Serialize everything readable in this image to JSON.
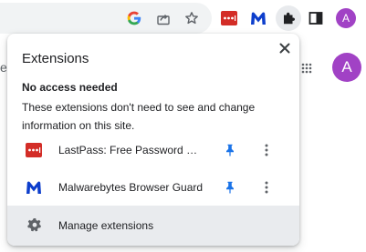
{
  "toolbar": {
    "google_icon": "google-g-icon",
    "share_icon": "share-icon",
    "bookmark_icon": "star-icon",
    "extensions": [
      {
        "name": "lastpass-extension-icon"
      },
      {
        "name": "malwarebytes-extension-icon"
      }
    ],
    "puzzle_icon": "puzzle-icon",
    "sidepanel_icon": "side-panel-icon",
    "avatar_letter": "A"
  },
  "page": {
    "edge_text": "e",
    "avatar_letter": "A"
  },
  "popup": {
    "title": "Extensions",
    "close_icon": "close-icon",
    "section_title": "No access needed",
    "section_desc": "These extensions don't need to see and change information on this site.",
    "items": [
      {
        "label": "LastPass: Free Password Manager",
        "icon": "lastpass-icon",
        "pinned": true
      },
      {
        "label": "Malwarebytes Browser Guard",
        "icon": "malwarebytes-icon",
        "pinned": true
      }
    ],
    "manage_label": "Manage extensions"
  },
  "colors": {
    "accent": "#1a73e8",
    "lastpass": "#d32d27",
    "malwarebytes": "#0d3ecc",
    "avatar": "#a142c5",
    "footer_bg": "#e9ebee"
  }
}
